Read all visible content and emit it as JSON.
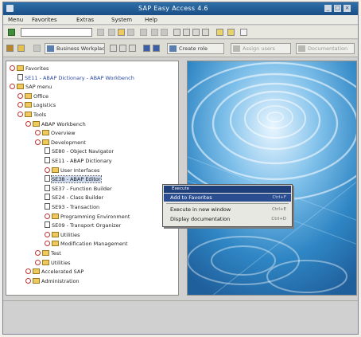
{
  "window": {
    "title": "SAP Easy Access 4.6",
    "system_icon": "sap-system-icon",
    "controls": [
      "_",
      "□",
      "×"
    ]
  },
  "menubar": {
    "items": [
      "Menu",
      "Favorites",
      "Extras",
      "System",
      "Help"
    ]
  },
  "command_field": {
    "value": "",
    "placeholder": ""
  },
  "app_toolbar": {
    "buttons": [
      {
        "label": "",
        "icon": "user-menu-icon"
      },
      {
        "label": "",
        "icon": "sap-menu-icon"
      },
      {
        "label": "Business Workplace",
        "icon": "workplace-icon"
      },
      {
        "label": "",
        "icon": "favorites-add-icon"
      },
      {
        "label": "",
        "icon": "favorites-remove-icon"
      },
      {
        "label": "",
        "icon": "change-favorites-icon"
      },
      {
        "label": "",
        "icon": "move-down-icon"
      },
      {
        "label": "",
        "icon": "move-up-icon"
      },
      {
        "label": "Create role",
        "icon": "create-role-icon"
      },
      {
        "label": "Assign users",
        "icon": "assign-users-icon"
      },
      {
        "label": "Documentation",
        "icon": "documentation-icon"
      }
    ]
  },
  "tree": {
    "nodes": [
      {
        "label": "Favorites",
        "level": 0,
        "kind": "folder",
        "expanded": true,
        "blue": false
      },
      {
        "label": "SE11 - ABAP Dictionary - ABAP Workbench",
        "level": 1,
        "kind": "leaf",
        "expanded": false,
        "blue": true
      },
      {
        "label": "SAP menu",
        "level": 0,
        "kind": "folder",
        "expanded": true,
        "blue": false
      },
      {
        "label": "Office",
        "level": 1,
        "kind": "folder",
        "expanded": false,
        "blue": false
      },
      {
        "label": "Logistics",
        "level": 1,
        "kind": "folder",
        "expanded": false,
        "blue": false
      },
      {
        "label": "Tools",
        "level": 1,
        "kind": "folder",
        "expanded": true,
        "blue": false
      },
      {
        "label": "ABAP Workbench",
        "level": 2,
        "kind": "folder",
        "expanded": true,
        "blue": false
      },
      {
        "label": "Overview",
        "level": 3,
        "kind": "folder",
        "expanded": false,
        "blue": false
      },
      {
        "label": "Development",
        "level": 3,
        "kind": "folder",
        "expanded": true,
        "blue": false
      },
      {
        "label": "SE80 - Object Navigator",
        "level": 4,
        "kind": "leaf",
        "expanded": false,
        "blue": false
      },
      {
        "label": "SE11 - ABAP Dictionary",
        "level": 4,
        "kind": "leaf",
        "expanded": false,
        "blue": false
      },
      {
        "label": "User Interfaces",
        "level": 4,
        "kind": "folder",
        "expanded": false,
        "blue": false
      },
      {
        "label": "SE38 - ABAP Editor",
        "level": 4,
        "kind": "leaf",
        "expanded": false,
        "blue": false,
        "selected": true
      },
      {
        "label": "SE37 - Function Builder",
        "level": 4,
        "kind": "leaf",
        "expanded": false,
        "blue": false
      },
      {
        "label": "SE24 - Class Builder",
        "level": 4,
        "kind": "leaf",
        "expanded": false,
        "blue": false
      },
      {
        "label": "SE93 - Transaction",
        "level": 4,
        "kind": "leaf",
        "expanded": false,
        "blue": false
      },
      {
        "label": "Programming Environment",
        "level": 4,
        "kind": "folder",
        "expanded": false,
        "blue": false
      },
      {
        "label": "SE09 - Transport Organizer",
        "level": 4,
        "kind": "leaf",
        "expanded": false,
        "blue": false
      },
      {
        "label": "Utilities",
        "level": 4,
        "kind": "folder",
        "expanded": false,
        "blue": false
      },
      {
        "label": "Modification Management",
        "level": 4,
        "kind": "folder",
        "expanded": false,
        "blue": false
      },
      {
        "label": "Test",
        "level": 3,
        "kind": "folder",
        "expanded": false,
        "blue": false
      },
      {
        "label": "Utilities",
        "level": 3,
        "kind": "folder",
        "expanded": false,
        "blue": false
      },
      {
        "label": "Accelerated SAP",
        "level": 2,
        "kind": "folder",
        "expanded": false,
        "blue": false
      },
      {
        "label": "Administration",
        "level": 2,
        "kind": "folder",
        "expanded": false,
        "blue": false
      }
    ]
  },
  "context_menu": {
    "header": "Execute",
    "items": [
      {
        "label": "Add to Favorites",
        "accel": "Ctrl+F",
        "highlighted": true
      },
      {
        "label": "Execute in new window",
        "accel": "Ctrl+E",
        "highlighted": false
      },
      {
        "label": "Display documentation",
        "accel": "Ctrl+D",
        "highlighted": false
      }
    ]
  },
  "colors": {
    "title_bar": "#1b4e87",
    "menu_highlight": "#2b4e91",
    "folder": "#f0c95c",
    "water": "#3a8bc7"
  }
}
